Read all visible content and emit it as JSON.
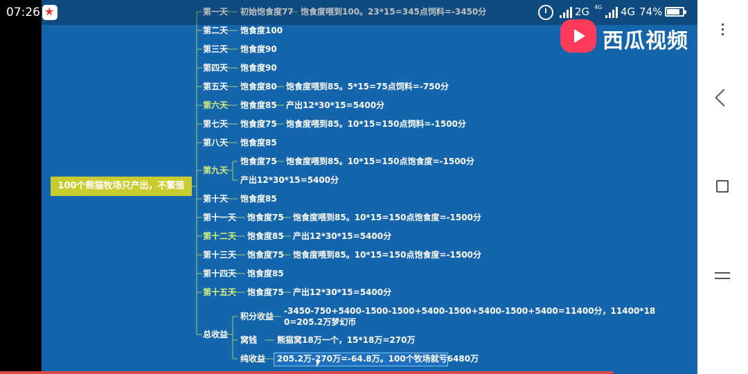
{
  "status": {
    "time": "07:26",
    "net1": "2G",
    "net2": "4G",
    "net_sub": "4G",
    "battery": "74%"
  },
  "brand": {
    "logo_text": "西瓜视频"
  },
  "mindmap": {
    "root": "100个熊猫牧场只产出，不繁殖",
    "days": [
      {
        "day": "第一天",
        "a": "初始饱食度77",
        "b": "饱食度喂到100。23*15=345点饲料=-3450分"
      },
      {
        "day": "第二天",
        "a": "饱食度100",
        "b": ""
      },
      {
        "day": "第三天",
        "a": "饱食度90",
        "b": ""
      },
      {
        "day": "第四天",
        "a": "饱食度90",
        "b": ""
      },
      {
        "day": "第五天",
        "a": "饱食度80",
        "b": "饱食度喂到85。5*15=75点饲料=-750分"
      },
      {
        "day": "第六天",
        "a": "饱食度85",
        "b": "产出12*30*15=5400分"
      },
      {
        "day": "第七天",
        "a": "饱食度75",
        "b": "饱食度喂到85。10*15=150点饲料=-1500分"
      },
      {
        "day": "第八天",
        "a": "饱食度85",
        "b": ""
      },
      {
        "day": "第九天",
        "a": "饱食度75",
        "b": "饱食度喂到85。10*15=150点饱食度=-1500分",
        "a2": "产出12*30*15=5400分"
      },
      {
        "day": "第十天",
        "a": "饱食度85",
        "b": ""
      },
      {
        "day": "第十一天",
        "a": "饱食度75",
        "b": "饱食度喂到85。10*15=150点饱食度=-1500分"
      },
      {
        "day": "第十二天",
        "a": "饱食度85",
        "b": "产出12*30*15=5400分"
      },
      {
        "day": "第十三天",
        "a": "饱食度75",
        "b": "饱食度喂到85。10*15=150点饱食度=-1500分"
      },
      {
        "day": "第十四天",
        "a": "饱食度85",
        "b": ""
      },
      {
        "day": "第十五天",
        "a": "饱食度75",
        "b": "产出12*30*15=5400分"
      }
    ],
    "summary": {
      "label": "总收益",
      "points_label": "积分收益",
      "points_line1": "-3450-750+5400-1500-1500+5400-1500+5400-1500+5400=11400分，11400*18",
      "points_line2": "0=205.2万梦幻币",
      "nest_label": "窝钱",
      "nest_value": "熊猫窝18万一个，15*18万=270万",
      "net_label": "纯收益",
      "net_value": "205.2万-270万=-64.8万。100个牧场就亏6480万"
    }
  }
}
